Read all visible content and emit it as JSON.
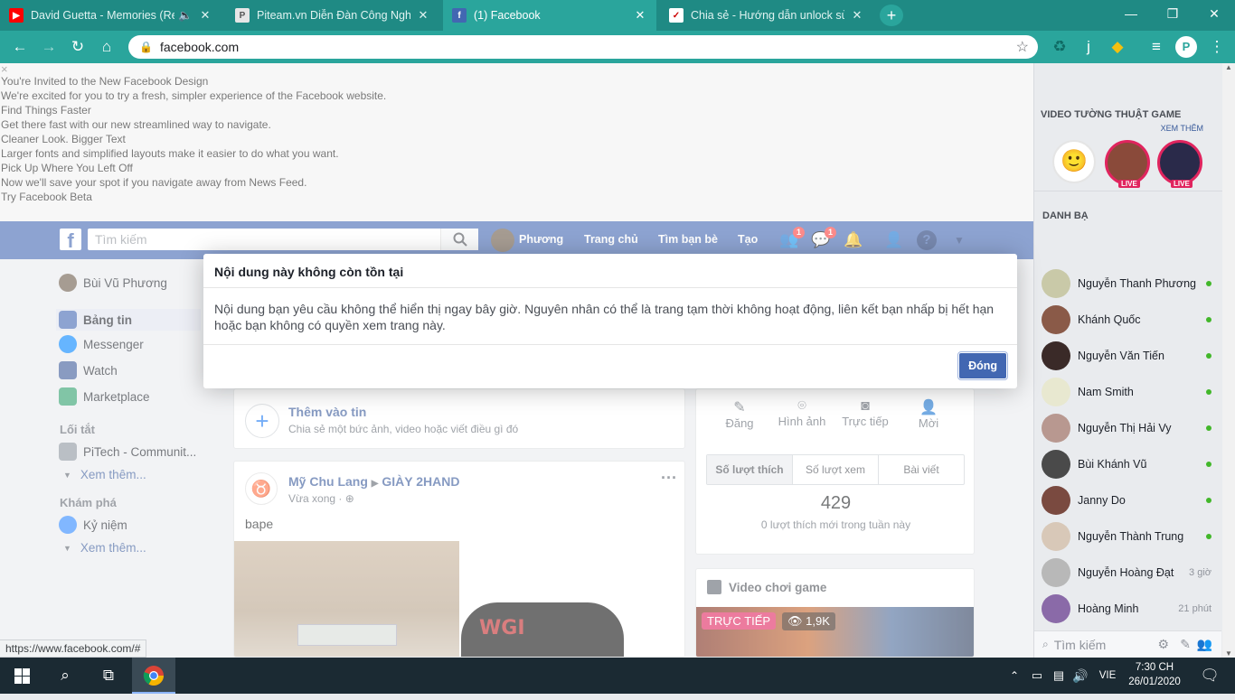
{
  "browser": {
    "tabs": [
      {
        "title": "David Guetta - Memories (Re",
        "favicon_color": "#ff0000",
        "active": false
      },
      {
        "title": "Piteam.vn Diễn Đàn Công Nghệ",
        "favicon_color": "#e6e6e6",
        "active": false
      },
      {
        "title": "(1) Facebook",
        "favicon_color": "#4267b2",
        "active": true
      },
      {
        "title": "Chia sẻ - Hướng dẫn unlock sử d",
        "favicon_color": "#ffffff",
        "active": false
      }
    ],
    "url": "facebook.com",
    "accent": "#2aa59c"
  },
  "banner": {
    "lines": [
      "You're Invited to the New Facebook Design",
      "We're excited for you to try a fresh, simpler experience of the Facebook website.",
      "Find Things Faster",
      "Get there fast with our new streamlined way to navigate.",
      "Cleaner Look. Bigger Text",
      "Larger fonts and simplified layouts make it easier to do what you want.",
      "Pick Up Where You Left Off",
      "Now we'll save your spot if you navigate away from News Feed.",
      "Try Facebook Beta"
    ],
    "close": "×"
  },
  "fb_header": {
    "search_placeholder": "Tìm kiếm",
    "profile_name": "Phương",
    "home": "Trang chủ",
    "find_friends": "Tìm bạn bè",
    "create": "Tạo",
    "friend_requests_badge": "1",
    "messages_badge": "1"
  },
  "left_nav": {
    "user": "Bùi Vũ Phương",
    "items": [
      "Bảng tin",
      "Messenger",
      "Watch",
      "Marketplace"
    ],
    "shortcuts_title": "Lối tắt",
    "shortcut_item": "PiTech - Communit...",
    "see_more": "Xem thêm...",
    "explore_title": "Khám phá",
    "explore_item": "Kỷ niệm",
    "see_more_2": "Xem thêm..."
  },
  "dialog": {
    "title": "Nội dung này không còn tồn tại",
    "body": "Nội dung bạn yêu cầu không thể hiển thị ngay bây giờ. Nguyên nhân có thể là trang tạm thời không hoạt động, liên kết bạn nhấp bị hết hạn hoặc bạn không có quyền xem trang này.",
    "close_button": "Đóng"
  },
  "story": {
    "title": "Thêm vào tin",
    "subtitle": "Chia sẻ một bức ảnh, video hoặc viết điều gì đó"
  },
  "post": {
    "author": "Mỹ Chu Lang",
    "group": "GIÀY 2HAND",
    "time": "Vừa xong ·",
    "text": "bape",
    "image_text": "WGI"
  },
  "page_panel": {
    "actions": [
      "Đăng",
      "Hình ảnh",
      "Trực tiếp",
      "Mời"
    ],
    "tabs": [
      "Số lượt thích",
      "Số lượt xem",
      "Bài viết"
    ],
    "likes": "429",
    "likes_caption": "0 lượt thích mới trong tuần này"
  },
  "game_video": {
    "title": "Video chơi game",
    "live": "TRỰC TIẾP",
    "views": "1,9K"
  },
  "right_sidebar": {
    "video_title": "VIDEO TƯỜNG THUẬT GAME",
    "see_more": "XEM THÊM",
    "live": "LIVE",
    "contacts_title": "DANH BẠ",
    "contacts": [
      {
        "name": "Nguyễn Thanh Phương",
        "status": "online",
        "color": "#c9c9a8"
      },
      {
        "name": "Khánh Quốc",
        "status": "online",
        "color": "#8a5a48"
      },
      {
        "name": "Nguyễn Văn Tiến",
        "status": "online",
        "color": "#3a2a28"
      },
      {
        "name": "Nam Smith",
        "status": "online",
        "color": "#e8e8d0"
      },
      {
        "name": "Nguyễn Thị Hải Vy",
        "status": "online",
        "color": "#b89890"
      },
      {
        "name": "Bùi Khánh Vũ",
        "status": "online",
        "color": "#4a4a4a"
      },
      {
        "name": "Janny Do",
        "status": "online",
        "color": "#7a4a40"
      },
      {
        "name": "Nguyễn Thành Trung",
        "status": "online",
        "color": "#d8c8b8"
      },
      {
        "name": "Nguyễn Hoàng Đạt",
        "status": "3 giờ",
        "color": "#b8b8b8"
      },
      {
        "name": "Hoàng Minh",
        "status": "21 phút",
        "color": "#8a6aa8"
      }
    ],
    "search_placeholder": "Tìm kiếm"
  },
  "status_url": "https://www.facebook.com/#",
  "taskbar": {
    "lang": "VIE",
    "time": "7:30 CH",
    "date": "26/01/2020"
  }
}
